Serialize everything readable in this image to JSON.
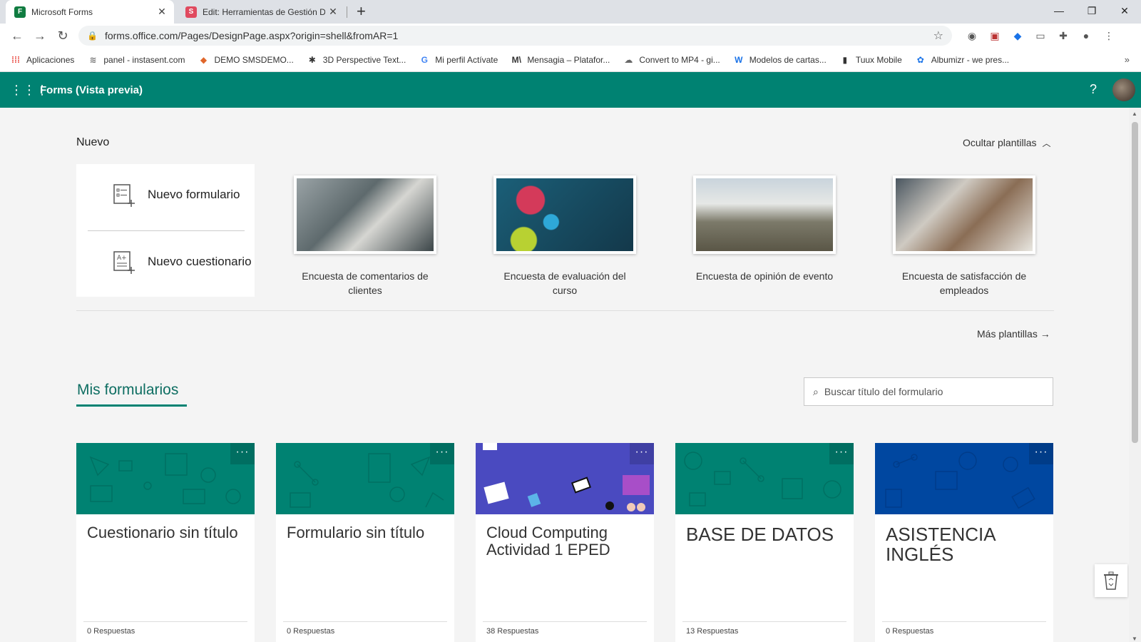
{
  "browser": {
    "tabs": [
      {
        "title": "Microsoft Forms",
        "favicon": "F",
        "favicon_color": "#008272"
      },
      {
        "title": "Edit: Herramientas de Gestión Di",
        "favicon": "S",
        "favicon_color": "#e04a5f"
      }
    ],
    "url": "forms.office.com/Pages/DesignPage.aspx?origin=shell&fromAR=1",
    "bookmarks": [
      {
        "label": "Aplicaciones",
        "icon": "apps-grid-icon"
      },
      {
        "label": "panel - instasent.com",
        "icon": "instasent-icon"
      },
      {
        "label": "DEMO SMSDEMO...",
        "icon": "diamond-icon"
      },
      {
        "label": "3D Perspective Text...",
        "icon": "spider-icon"
      },
      {
        "label": "Mi perfil Actívate",
        "icon": "google-icon"
      },
      {
        "label": "Mensagia – Platafor...",
        "icon": "mensagia-icon"
      },
      {
        "label": "Convert to MP4 - gi...",
        "icon": "cloud-icon"
      },
      {
        "label": "Modelos de cartas...",
        "icon": "w-icon"
      },
      {
        "label": "Tuux Mobile",
        "icon": "tuux-icon"
      },
      {
        "label": "Albumizr - we pres...",
        "icon": "albumizr-icon"
      }
    ]
  },
  "app": {
    "title": "Forms (Vista previa)",
    "help": "?"
  },
  "nuevo": {
    "label": "Nuevo",
    "hide_templates": "Ocultar plantillas",
    "new_form": "Nuevo formulario",
    "new_quiz": "Nuevo cuestionario",
    "more_templates": "Más plantillas"
  },
  "templates": [
    {
      "caption": "Encuesta de comentarios de clientes"
    },
    {
      "caption": "Encuesta de evaluación del curso"
    },
    {
      "caption": "Encuesta de opinión de evento"
    },
    {
      "caption": "Encuesta de satisfacción de empleados"
    }
  ],
  "my_forms": {
    "title": "Mis formularios",
    "search_placeholder": "Buscar título del formulario",
    "cards": [
      {
        "title": "Cuestionario sin título",
        "responses": "0 Respuestas",
        "color": "#008272"
      },
      {
        "title": "Formulario sin título",
        "responses": "0 Respuestas",
        "color": "#008272"
      },
      {
        "title": "Cloud Computing Actividad 1 EPED",
        "responses": "38 Respuestas",
        "color": "#4a4ac0"
      },
      {
        "title": "BASE DE DATOS",
        "responses": "13 Respuestas",
        "color": "#008272"
      },
      {
        "title": "ASISTENCIA INGLÉS",
        "responses": "0 Respuestas",
        "color": "#0047a0"
      }
    ]
  }
}
